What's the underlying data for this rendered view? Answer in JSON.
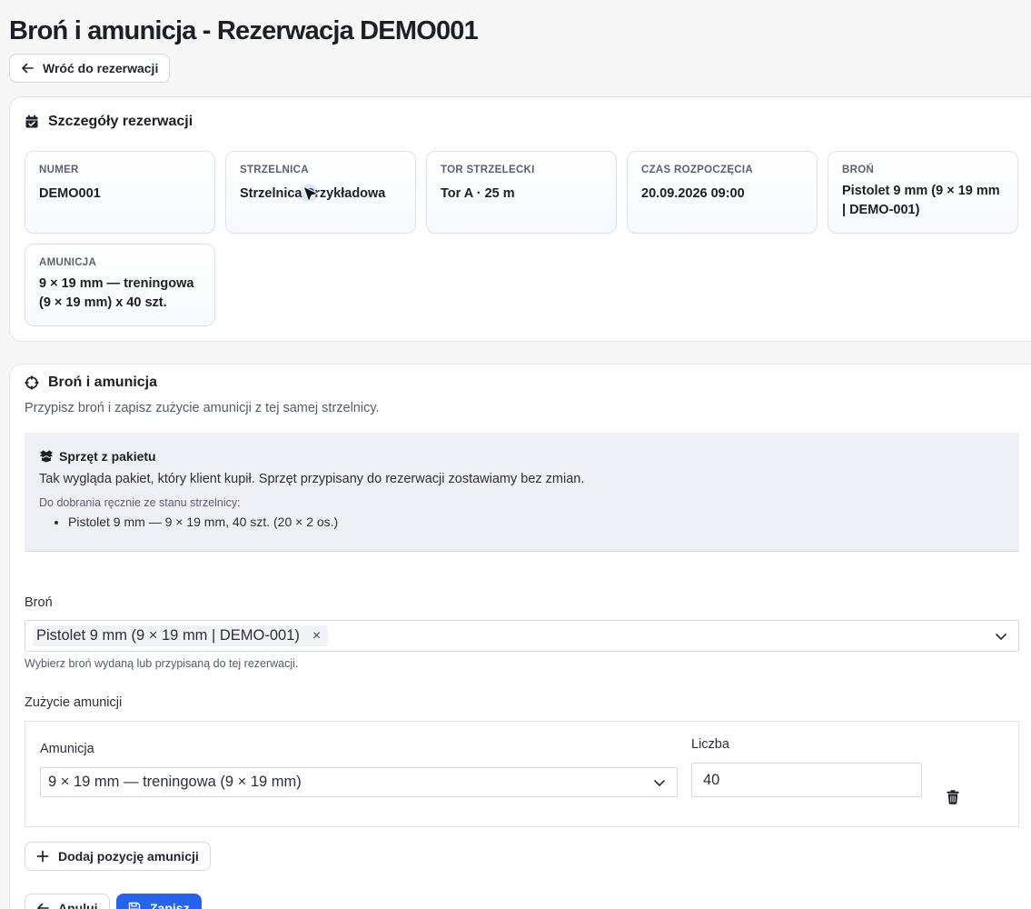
{
  "page": {
    "title": "Broń i amunicja - Rezerwacja DEMO001",
    "back_label": "Wróć do rezerwacji"
  },
  "details": {
    "heading": "Szczegóły rezerwacji",
    "tiles": [
      {
        "label": "NUMER",
        "value": "DEMO001"
      },
      {
        "label": "STRZELNICA",
        "value": "Strzelnica Przykładowa"
      },
      {
        "label": "TOR STRZELECKI",
        "value": "Tor A · 25 m"
      },
      {
        "label": "CZAS ROZPOCZĘCIA",
        "value": "20.09.2026 09:00"
      },
      {
        "label": "BROŃ",
        "value": "Pistolet 9 mm (9 × 19 mm | DEMO-001)"
      },
      {
        "label": "AMUNICJA",
        "value": "9 × 19 mm — treningowa (9 × 19 mm) x 40 szt."
      }
    ]
  },
  "weapons": {
    "heading": "Broń i amunicja",
    "subtitle": "Przypisz broń i zapisz zużycie amunicji z tej samej strzelnicy.",
    "package": {
      "title": "Sprzęt z pakietu",
      "description": "Tak wygląda pakiet, który klient kupił. Sprzęt przypisany do rezerwacji zostawiamy bez zmian.",
      "note": "Do dobrania ręcznie ze stanu strzelnicy:",
      "items": [
        "Pistolet 9 mm — 9 × 19 mm, 40 szt. (20 × 2 os.)"
      ]
    },
    "weapon_field": {
      "label": "Broń",
      "selected": "Pistolet 9 mm (9 × 19 mm | DEMO-001)",
      "remove_symbol": "×",
      "help": "Wybierz broń wydaną lub przypisaną do tej rezerwacji."
    },
    "usage": {
      "label": "Zużycie amunicji",
      "ammo_label": "Amunicja",
      "ammo_value": "9 × 19 mm — treningowa (9 × 19 mm)",
      "count_label": "Liczba",
      "count_value": "40"
    },
    "add_label": "Dodaj pozycję amunicji",
    "cancel_label": "Anuluj",
    "save_label": "Zapisz"
  },
  "colors": {
    "primary": "#2563eb",
    "background": "#f7f7f8",
    "panel": "#eef0f4"
  },
  "icons": [
    "arrow-left-icon",
    "calendar-check-icon",
    "crosshair-icon",
    "box-icon",
    "chevron-down-icon",
    "trash-icon",
    "plus-icon",
    "save-icon",
    "cursor-icon"
  ]
}
